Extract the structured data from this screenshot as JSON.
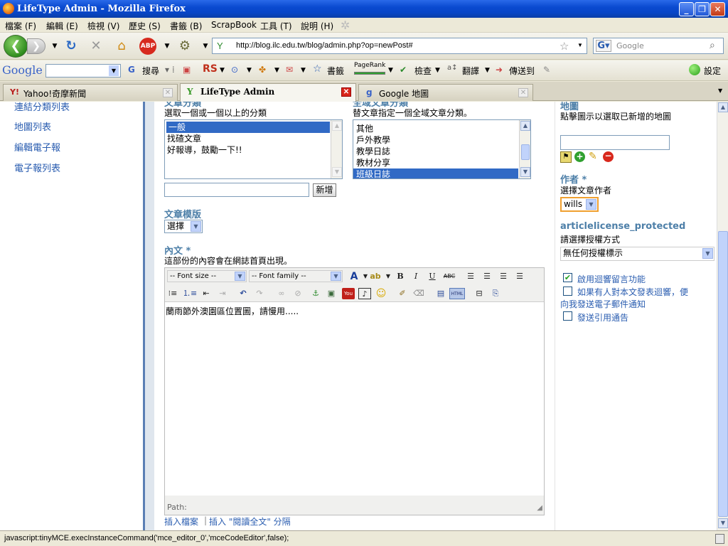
{
  "window": {
    "title": "LifeType Admin - Mozilla Firefox"
  },
  "menu": [
    "檔案 (F)",
    "編輯 (E)",
    "檢視 (V)",
    "歷史 (S)",
    "書籤 (B)",
    "ScrapBook",
    "工具 (T)",
    "說明 (H)"
  ],
  "nav": {
    "url": "http://blog.ilc.edu.tw/blog/admin.php?op=newPost#",
    "search_placeholder": "Google"
  },
  "google_toolbar": {
    "logo": "Google",
    "search": "搜尋",
    "rs": "RS",
    "bookmarks": "書籤",
    "pagerank": "PageRank",
    "check": "檢查",
    "translate": "翻譯",
    "send": "傳送到",
    "settings": "設定"
  },
  "tabs": [
    {
      "label": "Yahoo!奇摩新聞"
    },
    {
      "label": "LifeType Admin"
    },
    {
      "label": "Google 地圖"
    }
  ],
  "sidebar": {
    "items": [
      "連結分類列表",
      "地圖列表",
      "編輯電子報",
      "電子報列表"
    ]
  },
  "categories": {
    "title": "文章分類",
    "hint": "選取一個或一個以上的分類",
    "items": [
      "一般",
      "找碴文章",
      "好報導，鼓勵一下!!"
    ],
    "add_button": "新增"
  },
  "global_categories": {
    "title": "全域文章分類",
    "hint": "替文章指定一個全域文章分類。",
    "items": [
      "其他",
      "戶外教學",
      "教學日誌",
      "教材分享",
      "班級日誌"
    ]
  },
  "template": {
    "title": "文章模版",
    "select": "選擇"
  },
  "body": {
    "title": "內文 *",
    "hint": "這部份的內容會在網誌首頁出現。",
    "font_size": "-- Font size --",
    "font_family": "-- Font family --",
    "text": "蘭雨節外澳園區位置圖，請慢用.....",
    "path": "Path:",
    "insert_file": "插入檔案",
    "insert_more": "插入 \"閱讀全文\" 分隔"
  },
  "map": {
    "title": "地圖",
    "hint": "點擊圖示以選取已新增的地圖"
  },
  "author": {
    "title": "作者 *",
    "hint": "選擇文章作者",
    "value": "wills"
  },
  "license": {
    "title": "articlelicense_protected",
    "hint": "請選擇授權方式",
    "value": "無任何授權標示"
  },
  "options": [
    {
      "label": "啟用迴響留言功能",
      "checked": true
    },
    {
      "label": "如果有人對本文發表迴響，便向我發送電子郵件通知",
      "checked": false
    },
    {
      "label": "發送引用通告",
      "checked": false
    }
  ],
  "status": "javascript:tinyMCE.execInstanceCommand('mce_editor_0','mceCodeEditor',false);"
}
